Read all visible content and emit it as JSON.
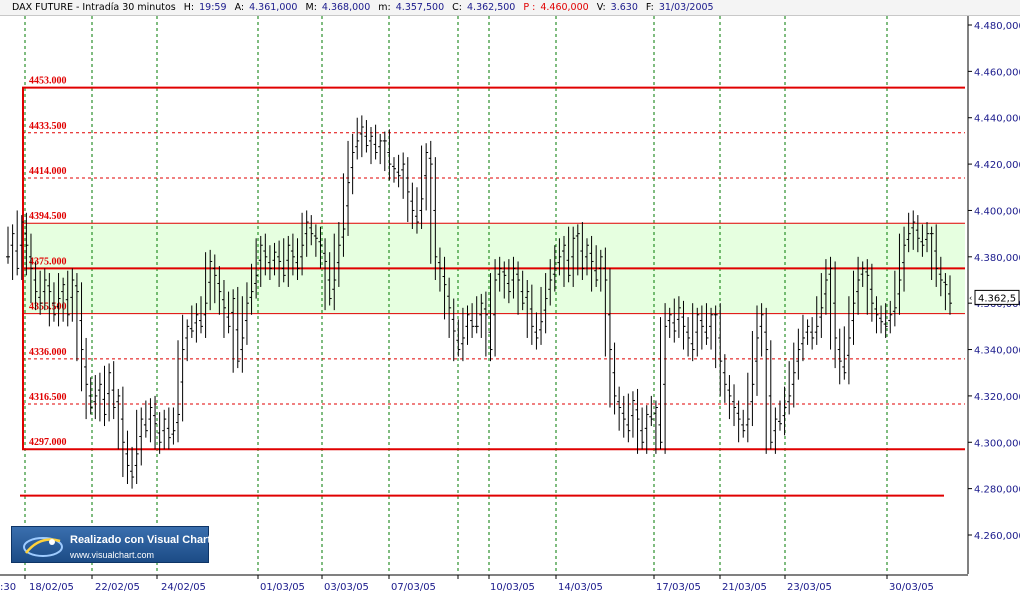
{
  "header": {
    "symbol": "DAX FUTURE - Intradía 30 minutos",
    "h_label": "H:",
    "h_value": "19:59",
    "a_label": "A:",
    "a_value": "4.361,000",
    "max_label": "M:",
    "max_value": "4.368,000",
    "min_label": "m:",
    "min_value": "4.357,500",
    "c_label": "C:",
    "c_value": "4.362,500",
    "p_label": "P :",
    "p_value": "4.460,000",
    "v_label": "V:",
    "v_value": "3.630",
    "f_label": "F:",
    "f_value": "31/03/2005"
  },
  "badge": {
    "title": "Realizado con Visual Chart",
    "url": "www.visualchart.com",
    "icon": "visual-chart-logo-icon"
  },
  "colors": {
    "bars": "#000000",
    "levels": "#e00000",
    "band_fill": "#e6ffe0",
    "grid": "#007a00",
    "axis": "#1a1a8c"
  },
  "chart_data": {
    "type": "bar",
    "ylim": [
      4250,
      4490
    ],
    "yticks": [
      {
        "value": 4480,
        "label": "4.480,000"
      },
      {
        "value": 4460,
        "label": "4.460,000"
      },
      {
        "value": 4440,
        "label": "4.440,000"
      },
      {
        "value": 4420,
        "label": "4.420,000"
      },
      {
        "value": 4400,
        "label": "4.400,000"
      },
      {
        "value": 4380,
        "label": "4.380,000"
      },
      {
        "value": 4360,
        "label": "4.360,000"
      },
      {
        "value": 4340,
        "label": "4.340,000"
      },
      {
        "value": 4320,
        "label": "4.320,000"
      },
      {
        "value": 4300,
        "label": "4.300,000"
      },
      {
        "value": 4280,
        "label": "4.280,000"
      },
      {
        "value": 4260,
        "label": "4.260,000"
      }
    ],
    "last_price_label": "4.362,5",
    "last_price_value": 4362.5,
    "x_labels": [
      ":30",
      "18/02/05",
      "22/02/05",
      "24/02/05",
      "01/03/05",
      "03/03/05",
      "07/03/05",
      "10/03/05",
      "14/03/05",
      "17/03/05",
      "21/03/05",
      "23/03/05",
      "30/03/05"
    ],
    "x_label_pos": [
      0,
      1,
      2,
      3,
      4,
      5,
      6,
      7,
      8,
      9,
      10,
      11,
      12
    ],
    "levels": [
      {
        "label": "4453.000",
        "value": 4453.0,
        "style": "solid"
      },
      {
        "label": "4433.500",
        "value": 4433.5,
        "style": "dashed"
      },
      {
        "label": "4414.000",
        "value": 4414.0,
        "style": "dashed"
      },
      {
        "label": "4394.500",
        "value": 4394.5,
        "style": "thin"
      },
      {
        "label": "4375.000",
        "value": 4375.0,
        "style": "solid"
      },
      {
        "label": "4355.500",
        "value": 4355.5,
        "style": "thin"
      },
      {
        "label": "4336.000",
        "value": 4336.0,
        "style": "dashed"
      },
      {
        "label": "4316.500",
        "value": 4316.5,
        "style": "dashed"
      },
      {
        "label": "4297.000",
        "value": 4297.0,
        "style": "solid"
      }
    ],
    "extra_level_value": 4277,
    "band": [
      4355.5,
      4394.5
    ],
    "series": [
      {
        "values": [
          4380,
          4390,
          4375,
          4395,
          4385,
          4375,
          4365,
          4360,
          4370,
          4365,
          4355,
          4362,
          4368,
          4355,
          4370,
          4365,
          4340,
          4325,
          4315,
          4320,
          4325,
          4312,
          4330,
          4315,
          4320,
          4300,
          4290,
          4285,
          4295,
          4310,
          4305,
          4315,
          4308,
          4300,
          4310,
          4302,
          4305,
          4312,
          4340,
          4350,
          4348,
          4355,
          4350,
          4360,
          4378,
          4372,
          4365,
          4358,
          4350,
          4362,
          4335,
          4345,
          4360,
          4365,
          4372,
          4385,
          4380,
          4375,
          4382,
          4378,
          4372,
          4385,
          4380,
          4375,
          4385,
          4395,
          4390,
          4388,
          4385,
          4378,
          4362,
          4370,
          4385,
          4392,
          4412,
          4425,
          4430,
          4436,
          4428,
          4432,
          4425,
          4430,
          4430,
          4420,
          4418,
          4415,
          4420,
          4408,
          4400,
          4395,
          4405,
          4425,
          4420,
          4380,
          4375,
          4368,
          4358,
          4348,
          4340,
          4345,
          4355,
          4350,
          4350,
          4360,
          4355,
          4340,
          4370,
          4375,
          4372,
          4365,
          4375,
          4370,
          4360,
          4365,
          4350,
          4345,
          4352,
          4362,
          4370,
          4375,
          4380,
          4385,
          4372,
          4388,
          4390,
          4375,
          4385,
          4378,
          4370,
          4380,
          4370,
          4340,
          4320,
          4315,
          4310,
          4305,
          4318,
          4310,
          4300,
          4312,
          4310,
          4315,
          4300,
          4350,
          4355,
          4348,
          4358,
          4350,
          4345,
          4340,
          4355,
          4350,
          4345,
          4355,
          4355,
          4335,
          4325,
          4320,
          4315,
          4310,
          4305,
          4310,
          4325,
          4345,
          4355,
          4340,
          4300,
          4310,
          4308,
          4315,
          4320,
          4330,
          4340,
          4345,
          4350,
          4345,
          4350,
          4358,
          4370,
          4375,
          4345,
          4335,
          4330,
          4345,
          4360,
          4370,
          4375,
          4372,
          4360,
          4355,
          4352,
          4350,
          4355,
          4358,
          4370,
          4385,
          4390,
          4395,
          4388,
          4385,
          4390,
          4390,
          4375,
          4370,
          4368,
          4360
        ]
      }
    ]
  }
}
